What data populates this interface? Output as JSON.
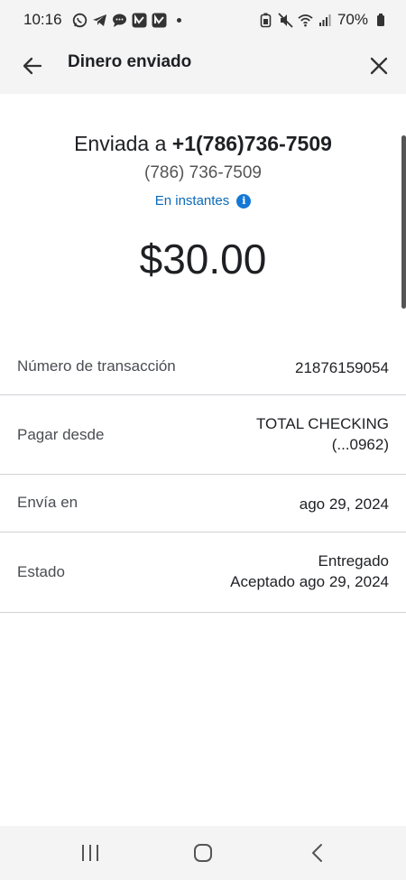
{
  "status_bar": {
    "time": "10:16",
    "battery": "70%",
    "icons_left": [
      "whatsapp-icon",
      "telegram-icon",
      "chat-icon",
      "app-n-icon",
      "app-n-icon"
    ],
    "icons_right": [
      "battery-saver-icon",
      "mute-icon",
      "wifi-icon",
      "signal-icon",
      "battery-icon"
    ]
  },
  "header": {
    "title": "Dinero enviado"
  },
  "summary": {
    "sent_prefix": "Enviada a ",
    "sent_number": "+1(786)736-7509",
    "phone": "(786) 736-7509",
    "timing": "En instantes",
    "amount": "$30.00"
  },
  "details": {
    "transaction": {
      "label": "Número de transacción",
      "value": "21876159054"
    },
    "pay_from": {
      "label": "Pagar desde",
      "value_line1": "TOTAL CHECKING",
      "value_line2": "(...0962)"
    },
    "send_on": {
      "label": "Envía en",
      "value": "ago 29, 2024"
    },
    "status": {
      "label": "Estado",
      "value_line1": "Entregado",
      "value_line2": "Aceptado ago 29, 2024"
    }
  },
  "colors": {
    "link": "#0b6ab7",
    "info_icon": "#1478d4",
    "divider": "#cfd2d6",
    "bar_bg": "#f4f4f4"
  }
}
